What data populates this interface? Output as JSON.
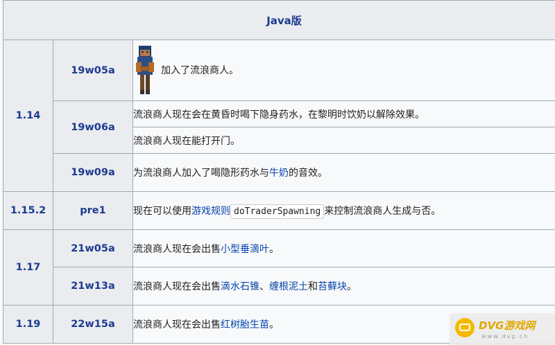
{
  "edition": "Java版",
  "versions": [
    "1.14",
    "1.15.2",
    "1.17",
    "1.19"
  ],
  "snapshots": [
    "19w05a",
    "19w06a",
    "19w09a",
    "pre1",
    "21w05a",
    "21w13a",
    "22w15a"
  ],
  "entries": {
    "e1": "加入了流浪商人。",
    "e2": "流浪商人现在会在黄昏时喝下隐身药水，在黎明时饮奶以解除效果。",
    "e3": "流浪商人现在能打开门。",
    "e4": {
      "pre": "为流浪商人加入了喝隐形药水与",
      "link": "牛奶",
      "post": "的音效。"
    },
    "e5": {
      "pre": "现在可以使用",
      "link": "游戏规则",
      "code": "doTraderSpawning",
      "post": "来控制流浪商人生成与否。"
    },
    "e6": {
      "pre": "流浪商人现在会出售",
      "link": "小型垂滴叶",
      "post": "。"
    },
    "e7": {
      "pre": "流浪商人现在会出售",
      "link1": "滴水石锥",
      "sep": "、",
      "link2": "缠根泥土",
      "and": "和",
      "link3": "苔藓块",
      "post": "。"
    },
    "e8": {
      "pre": "流浪商人现在会出售",
      "link": "红树胎生苗",
      "post": "。"
    }
  },
  "watermark": {
    "brand": "DVG游戏网",
    "sub": "www.dvg.cn"
  },
  "colors": {
    "header_bg": "#eaecf0",
    "link": "#0645ad",
    "version_text": "#1d3a8f"
  },
  "icons": [
    "wandering-trader-image",
    "dvg-logo-icon"
  ]
}
